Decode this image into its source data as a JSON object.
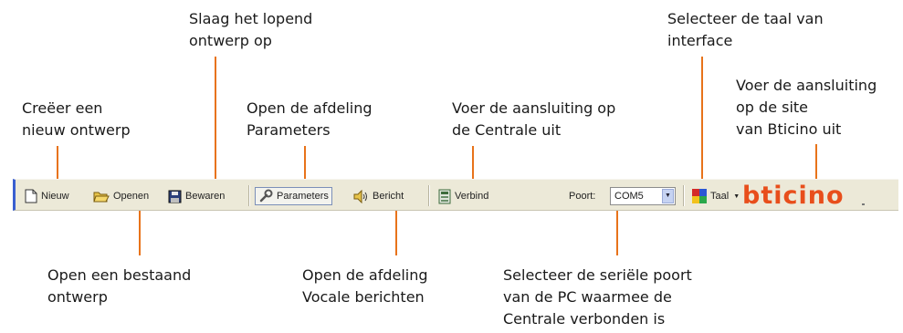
{
  "callouts": {
    "nieuw": [
      "Creëer een",
      "nieuw ontwerp"
    ],
    "bewaren": [
      "Slaag het lopend",
      "ontwerp op"
    ],
    "parameters": [
      "Open de afdeling",
      "Parameters"
    ],
    "verbind": [
      "Voer de aansluiting op",
      "de Centrale uit"
    ],
    "taal": [
      "Selecteer de taal van",
      "interface"
    ],
    "site": [
      "Voer de aansluiting",
      "op de site",
      "van Bticino uit"
    ],
    "openen": [
      "Open een bestaand",
      "ontwerp"
    ],
    "bericht": [
      "Open de afdeling",
      "Vocale berichten"
    ],
    "poort": [
      "Selecteer de seriële poort",
      "van de PC waarmee de",
      "Centrale verbonden is"
    ]
  },
  "toolbar": {
    "nieuw_label": "Nieuw",
    "openen_label": "Openen",
    "bewaren_label": "Bewaren",
    "parameters_label": "Parameters",
    "bericht_label": "Bericht",
    "verbind_label": "Verbind",
    "poort_label": "Poort:",
    "poort_value": "COM5",
    "taal_label": "Taal",
    "logo_text": "bticino"
  },
  "colors": {
    "callout_line": "#e8731a",
    "toolbar_bg": "#ece9d8",
    "logo": "#e84e1b",
    "accent_edge": "#3a5fd0"
  }
}
